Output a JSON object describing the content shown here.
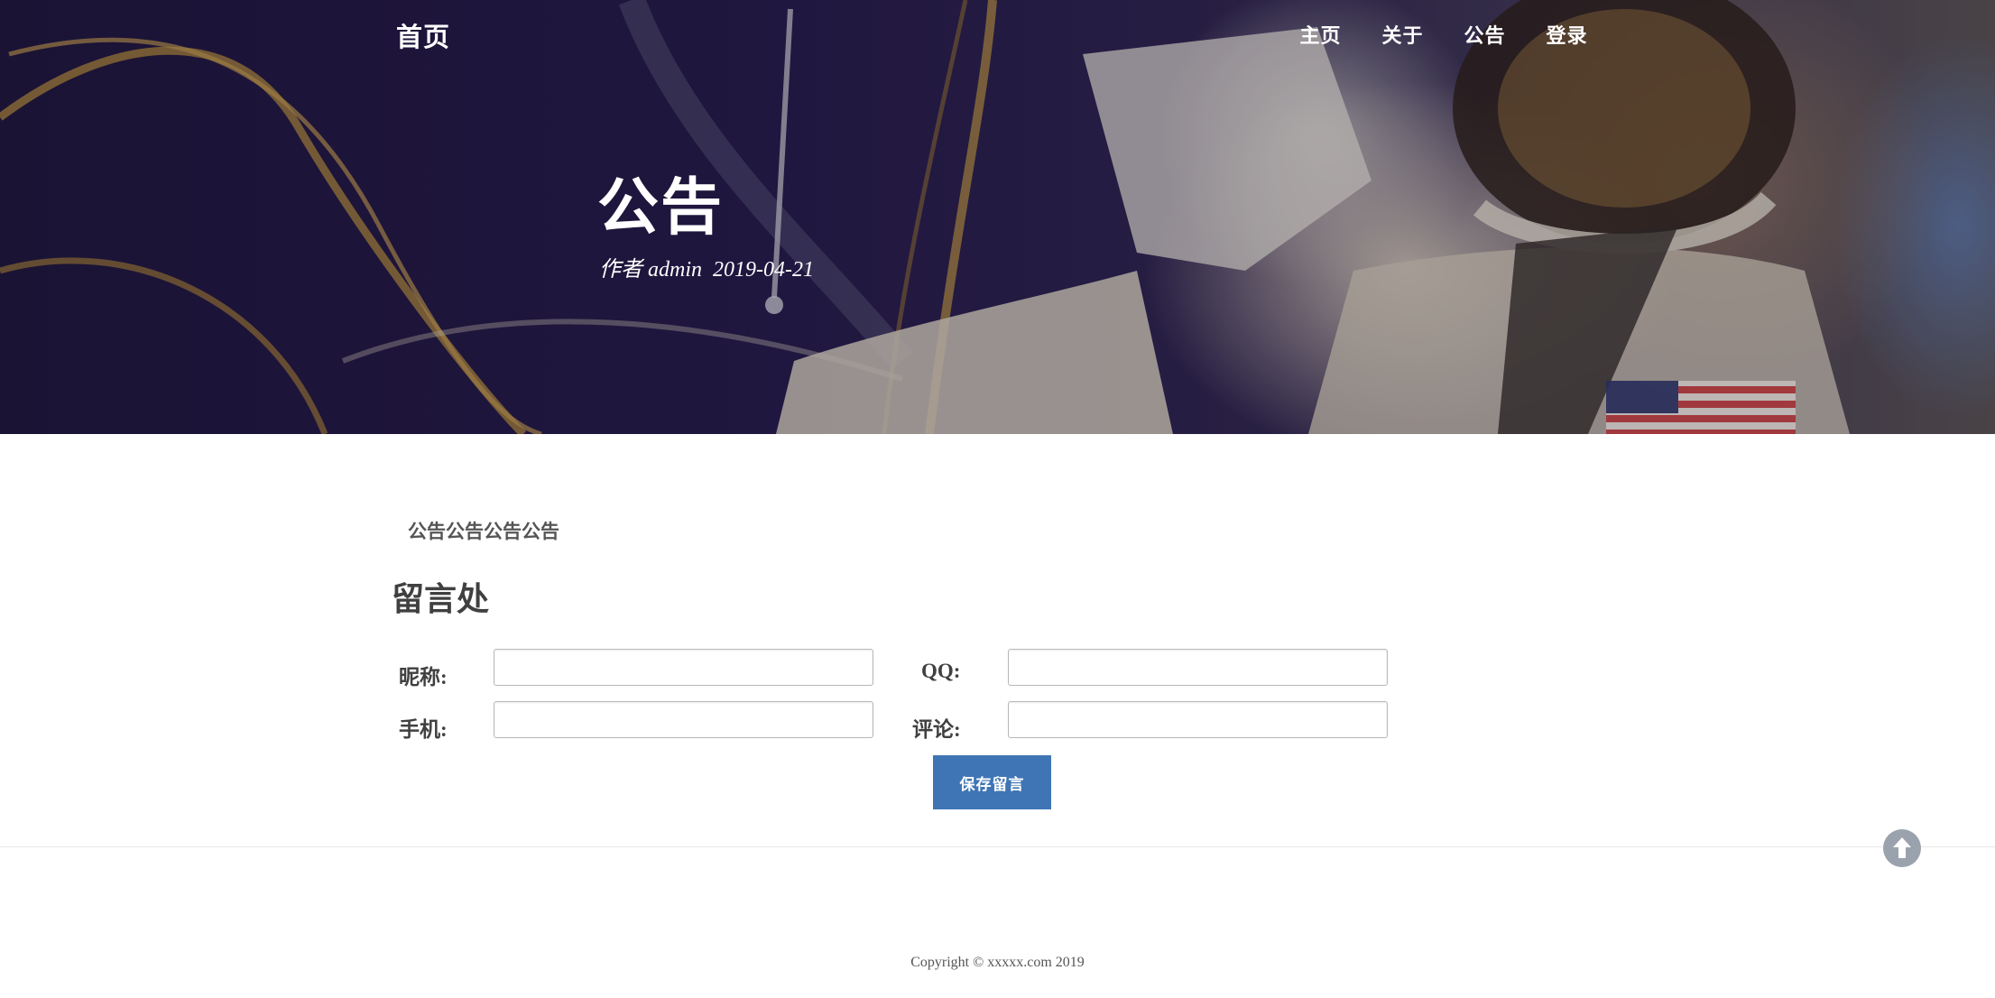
{
  "header": {
    "brand": "首页",
    "nav": [
      "主页",
      "关于",
      "公告",
      "登录"
    ],
    "title": "公告",
    "meta": "作者 admin  2019-04-21"
  },
  "content": {
    "text": "公告公告公告公告"
  },
  "comment_form": {
    "heading": "留言处",
    "nickname_label": "昵称:",
    "qq_label": "QQ:",
    "phone_label": "手机:",
    "comment_label": "评论:",
    "nickname_value": "",
    "qq_value": "",
    "phone_value": "",
    "comment_value": "",
    "submit_label": "保存留言"
  },
  "footer": {
    "copyright": "Copyright © xxxxx.com 2019"
  },
  "colors": {
    "button": "#3f75b5",
    "scroll_top_button": "#9aa2ad",
    "hero_dark": "#231a46"
  },
  "icons": {
    "scroll_top": "arrow-up-circle-icon"
  }
}
